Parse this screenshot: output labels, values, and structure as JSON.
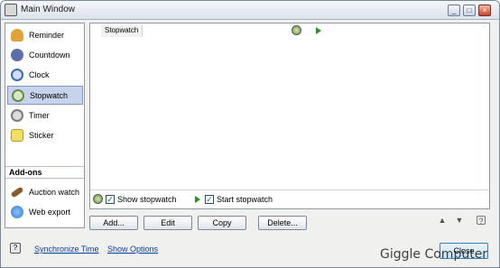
{
  "window": {
    "title": "Main Window",
    "controls": [
      "_",
      "□",
      "×"
    ]
  },
  "sidebar": {
    "items": [
      {
        "label": "Reminder",
        "icon": "bell-icon",
        "color": "#e0a23a"
      },
      {
        "label": "Countdown",
        "icon": "countdown-icon",
        "color": "#5a6fa8"
      },
      {
        "label": "Clock",
        "icon": "clock-icon",
        "color": "#3a6ab8"
      },
      {
        "label": "Stopwatch",
        "icon": "stopwatch-icon",
        "color": "#6c8a46",
        "selected": true
      },
      {
        "label": "Timer",
        "icon": "timer-icon",
        "color": "#7a7a7a"
      },
      {
        "label": "Sticker",
        "icon": "sticky-note-icon",
        "color": "#f2df6a"
      }
    ],
    "addons_header": "Add-ons",
    "addons": [
      {
        "label": "Auction watch",
        "icon": "hammer-icon",
        "color": "#8a5a2a"
      },
      {
        "label": "Web export",
        "icon": "globe-icon",
        "color": "#2c7ad6"
      }
    ]
  },
  "main": {
    "column_header": "Stopwatch",
    "options": {
      "show_label": "Show stopwatch",
      "show_checked": true,
      "start_label": "Start stopwatch",
      "start_checked": true
    },
    "check_glyph": "✓"
  },
  "toolbar": {
    "add": "Add...",
    "edit": "Edit",
    "copy": "Copy",
    "delete": "Delete..."
  },
  "move": {
    "up": "▲",
    "down": "▼",
    "help": "?"
  },
  "footer": {
    "help_glyph": "?",
    "sync_link": "Synchronize Time",
    "options_link": "Show Options",
    "close_label": "Close"
  },
  "watermark": "Giggle Computer"
}
